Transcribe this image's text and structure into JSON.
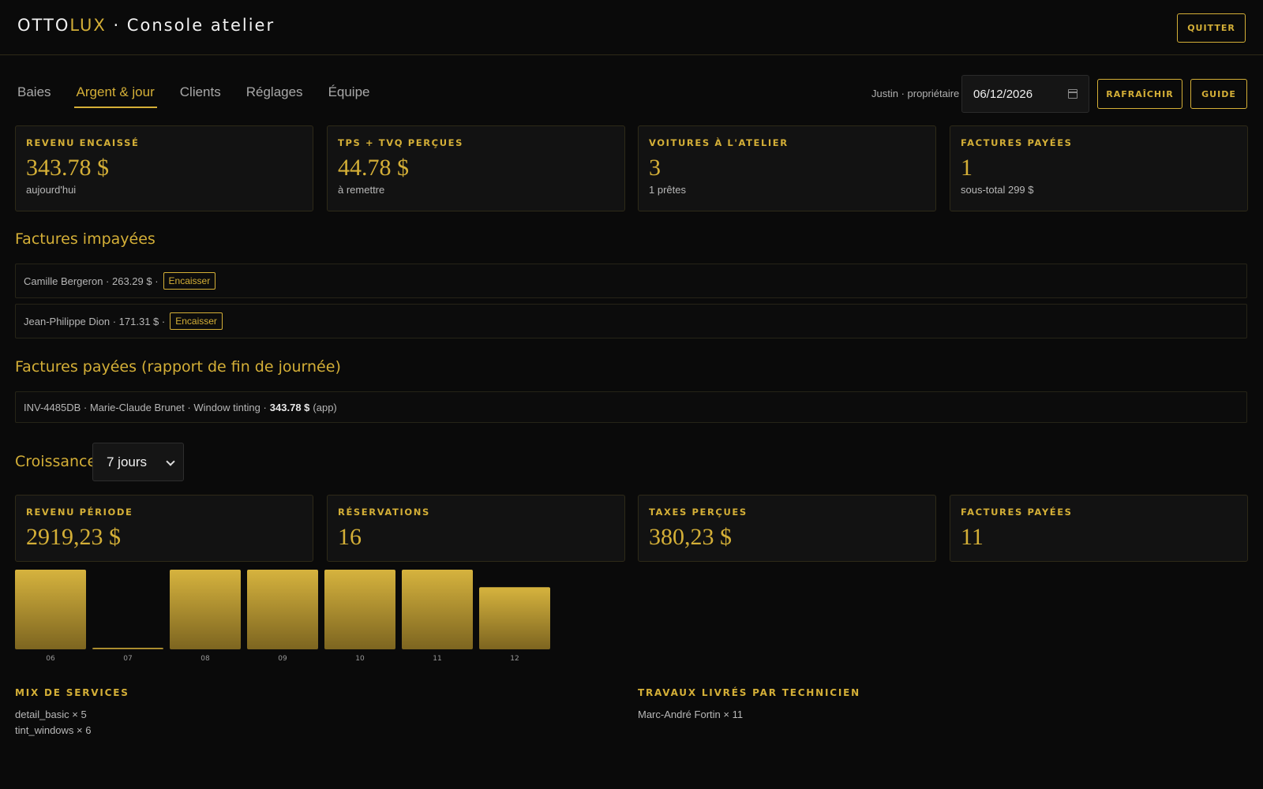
{
  "header": {
    "brand_otto": "OTTO",
    "brand_lux": "LUX",
    "brand_rest": " · Console atelier",
    "quit_label": "QUITTER"
  },
  "tabs": [
    {
      "label": "Baies",
      "active": false
    },
    {
      "label": "Argent & jour",
      "active": true
    },
    {
      "label": "Clients",
      "active": false
    },
    {
      "label": "Réglages",
      "active": false
    },
    {
      "label": "Équipe",
      "active": false
    }
  ],
  "toolbar": {
    "user": "Justin · propriétaire",
    "date_value": "06/12/2026",
    "refresh_label": "RAFRAÎCHIR",
    "guide_label": "GUIDE"
  },
  "today_stats": [
    {
      "label": "REVENU ENCAISSÉ",
      "value": "343.78 $",
      "sub": "aujourd'hui"
    },
    {
      "label": "TPS + TVQ PERÇUES",
      "value": "44.78 $",
      "sub": "à remettre"
    },
    {
      "label": "VOITURES À L'ATELIER",
      "value": "3",
      "sub": "1 prêtes"
    },
    {
      "label": "FACTURES PAYÉES",
      "value": "1",
      "sub": "sous-total 299 $"
    }
  ],
  "unpaid": {
    "title": "Factures impayées",
    "items": [
      {
        "text": "Camille Bergeron · 263.29 $ ·",
        "action": "Encaisser"
      },
      {
        "text": "Jean-Philippe Dion · 171.31 $ ·",
        "action": "Encaisser"
      }
    ]
  },
  "paid": {
    "title": "Factures payées (rapport de fin de journée)",
    "items": [
      {
        "prefix": "INV-4485DB · Marie-Claude Brunet · Window tinting ·",
        "amount": "343.78 $",
        "suffix": "(app)"
      }
    ]
  },
  "growth": {
    "title": "Croissance",
    "period_selected": "7 jours",
    "stats": [
      {
        "label": "REVENU PÉRIODE",
        "value": "2919,23 $"
      },
      {
        "label": "RÉSERVATIONS",
        "value": "16"
      },
      {
        "label": "TAXES PERÇUES",
        "value": "380,23 $"
      },
      {
        "label": "FACTURES PAYÉES",
        "value": "11"
      }
    ]
  },
  "chart_data": {
    "type": "bar",
    "categories": [
      "06",
      "07",
      "08",
      "09",
      "10",
      "11",
      "12"
    ],
    "values": [
      100,
      2,
      100,
      100,
      100,
      100,
      78
    ],
    "ylim": [
      0,
      100
    ],
    "title": "",
    "xlabel": "",
    "ylabel": "",
    "grid": false,
    "bar_color": "#d4af37"
  },
  "service_mix": {
    "label": "MIX DE SERVICES",
    "items": [
      "detail_basic × 5",
      "tint_windows × 6"
    ]
  },
  "tech_jobs": {
    "label": "TRAVAUX LIVRÉS PAR TECHNICIEN",
    "items": [
      "Marc-André Fortin × 11"
    ]
  },
  "colors": {
    "accent": "#d4af37",
    "background": "#0a0a0a"
  }
}
